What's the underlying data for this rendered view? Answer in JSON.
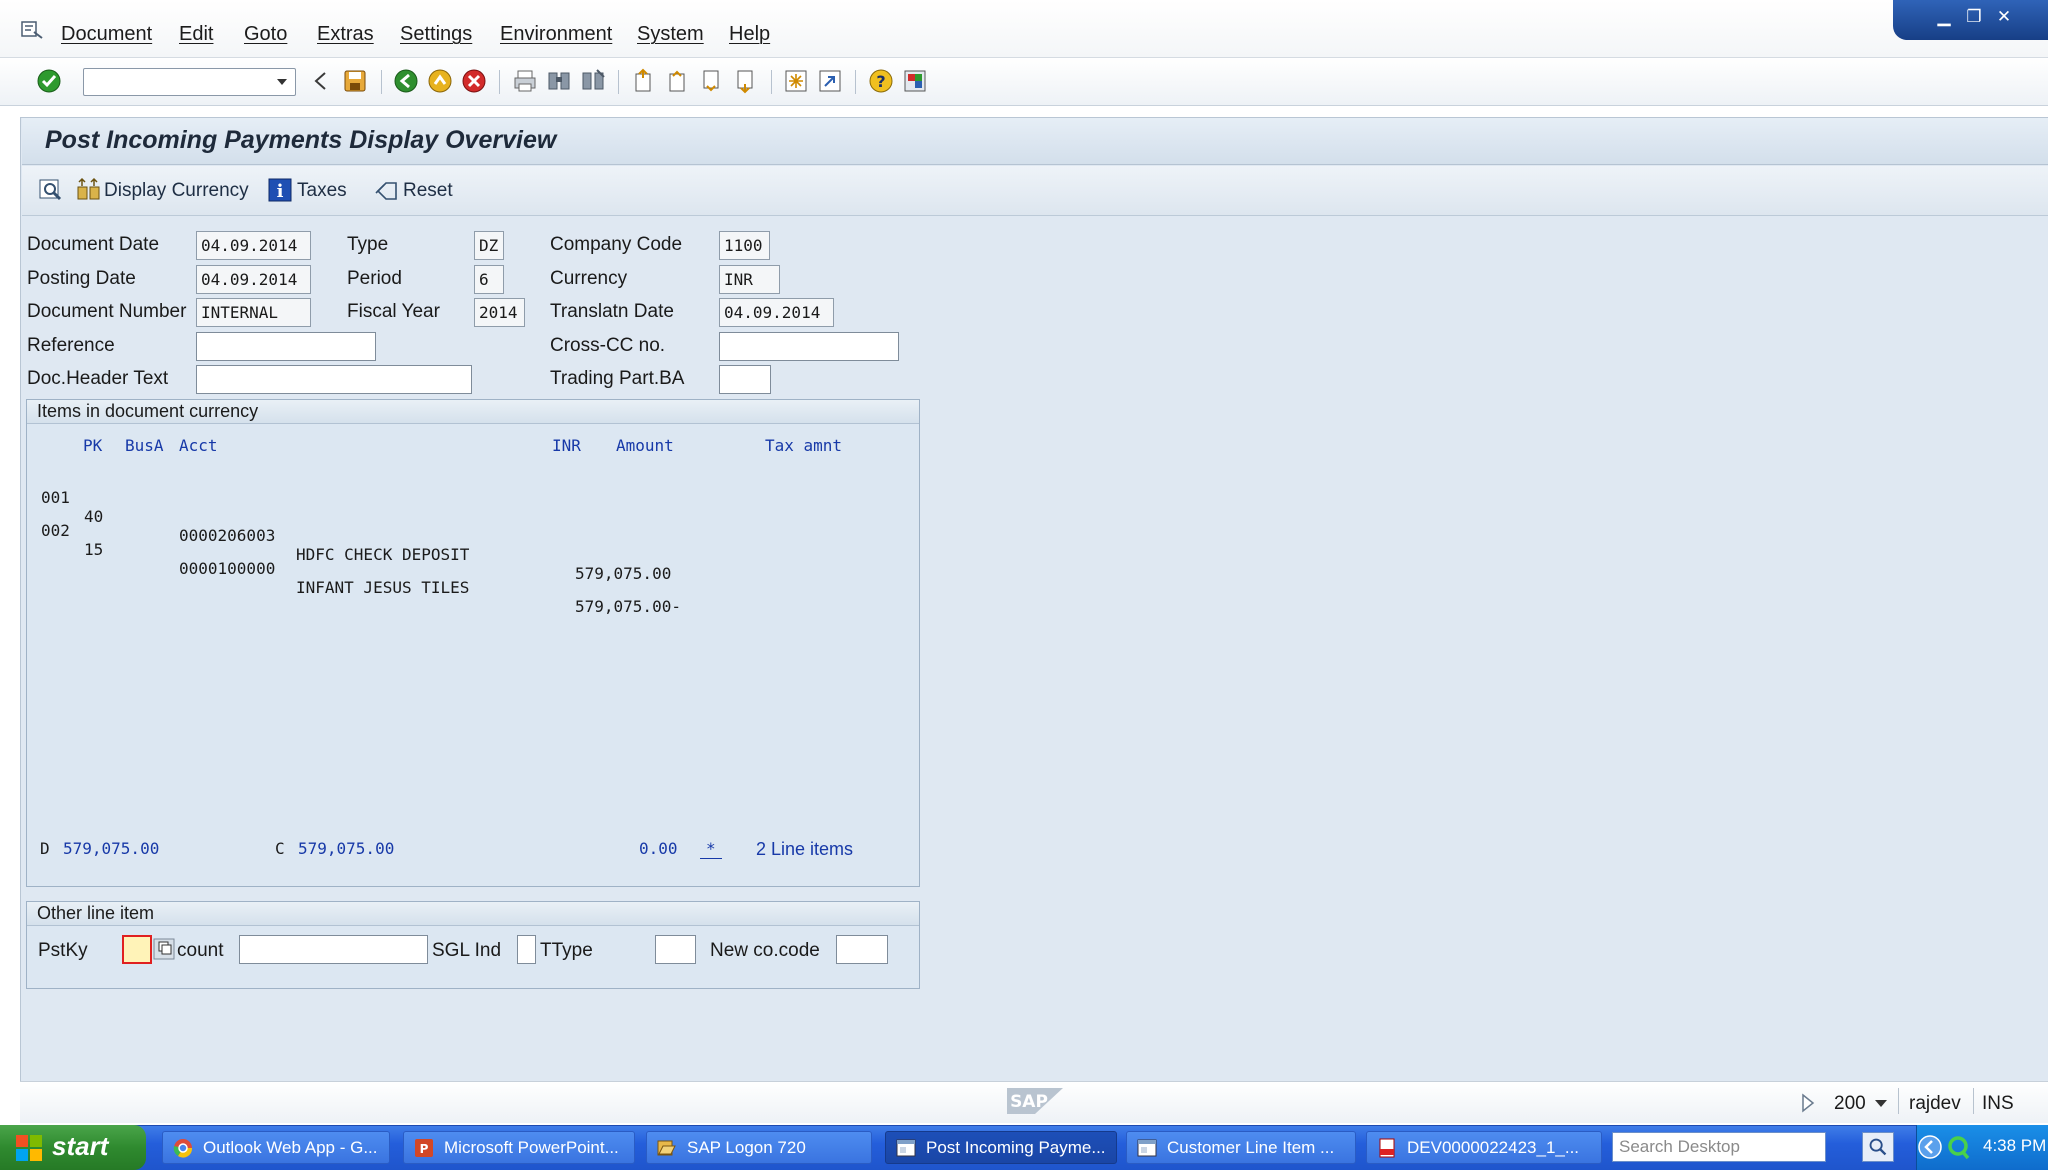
{
  "menu": [
    "Document",
    "Edit",
    "Goto",
    "Extras",
    "Settings",
    "Environment",
    "System",
    "Help"
  ],
  "page_title": "Post Incoming Payments Display Overview",
  "app_toolbar": {
    "display_currency": "Display Currency",
    "taxes": "Taxes",
    "reset": "Reset"
  },
  "header": {
    "document_date_label": "Document Date",
    "document_date": "04.09.2014",
    "type_label": "Type",
    "type": "DZ",
    "company_code_label": "Company Code",
    "company_code": "1100",
    "posting_date_label": "Posting Date",
    "posting_date": "04.09.2014",
    "period_label": "Period",
    "period": "6",
    "currency_label": "Currency",
    "currency": "INR",
    "document_number_label": "Document Number",
    "document_number": "INTERNAL",
    "fiscal_year_label": "Fiscal Year",
    "fiscal_year": "2014",
    "translation_date_label": "Translatn Date",
    "translation_date": "04.09.2014",
    "reference_label": "Reference",
    "cross_cc_label": "Cross-CC no.",
    "doc_header_text_label": "Doc.Header Text",
    "trading_part_label": "Trading Part.BA"
  },
  "items": {
    "title": "Items in document currency",
    "columns": {
      "pk": "PK",
      "busa": "BusA",
      "acct": "Acct",
      "inr": "INR",
      "amount": "Amount",
      "tax": "Tax amnt"
    },
    "rows": [
      {
        "line": "001",
        "pk": "40",
        "acct": "0000206003",
        "name": "HDFC CHECK DEPOSIT",
        "amount": "579,075.00"
      },
      {
        "line": "002",
        "pk": "15",
        "acct": "0000100000",
        "name": "INFANT JESUS TILES",
        "amount": "579,075.00-"
      }
    ],
    "totals": {
      "debit_label": "D",
      "debit": "579,075.00",
      "credit_label": "C",
      "credit": "579,075.00",
      "balance": "0.00",
      "balance_flag": "*",
      "line_items": "2 Line items"
    }
  },
  "other_line_item": {
    "title": "Other line item",
    "pstky_label": "PstKy",
    "account_label": "count",
    "sgl_label": "SGL Ind",
    "ttype_label": "TType",
    "new_cocode_label": "New co.code"
  },
  "status": {
    "client": "200",
    "user": "rajdev",
    "mode": "INS"
  },
  "taskbar": {
    "start": "start",
    "tasks": [
      "Outlook Web App - G...",
      "Microsoft PowerPoint...",
      "SAP Logon 720",
      "Post Incoming Payme...",
      "Customer Line Item ...",
      "DEV0000022423_1_..."
    ],
    "search_placeholder": "Search Desktop",
    "clock": "4:38 PM"
  },
  "colors": {
    "panel": "#dfe8f2",
    "column_header": "#1739a8",
    "taskbar": "#245edb",
    "start": "#2f8a2f"
  }
}
